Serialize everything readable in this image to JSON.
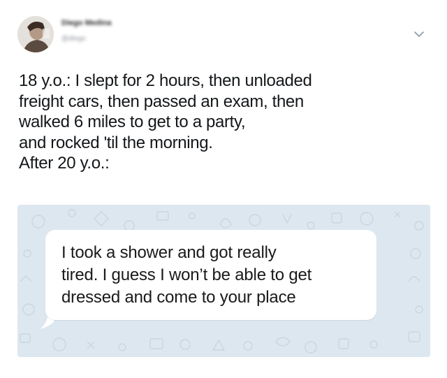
{
  "tweet": {
    "author": {
      "name": "Diego Medina",
      "handle": "@diego"
    },
    "text_lines": [
      "18 y.o.: I slept for 2 hours, then unloaded",
      "freight cars, then passed an exam, then",
      "walked 6 miles to get to a party,",
      "and rocked 'til the morning.",
      "After 20 y.o.:"
    ],
    "menu_icon": "chevron-down-icon",
    "media": {
      "background_color": "#dde7ef",
      "message_lines": [
        "I took a shower and got really",
        "tired. I guess I won’t be able to get",
        "dressed and come to your place"
      ]
    }
  }
}
